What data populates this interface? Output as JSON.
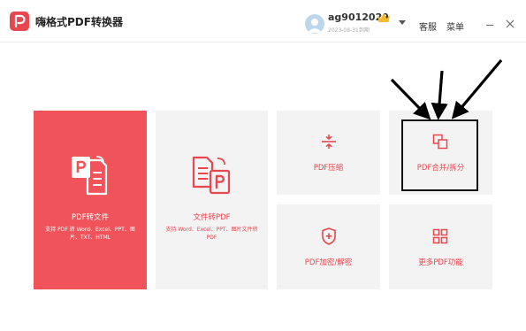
{
  "app": {
    "title": "嗨格式PDF转换器"
  },
  "user": {
    "name": "ag9012029",
    "expiry": "2023-08-31到期"
  },
  "header": {
    "support_label": "客服",
    "menu_label": "菜单"
  },
  "tiles": {
    "pdf_to_file": {
      "label": "PDF转文件",
      "desc": "支持 PDF 转 Word、Excel、PPT、图片、TXT、HTML"
    },
    "file_to_pdf": {
      "label": "文件转PDF",
      "desc": "支持 Word、Excel、PPT、图片文件转 PDF"
    },
    "compress": {
      "label": "PDF压缩"
    },
    "merge_split": {
      "label": "PDF合并/拆分"
    },
    "encrypt": {
      "label": "PDF加密/解密"
    },
    "more": {
      "label": "更多PDF功能"
    }
  },
  "colors": {
    "accent": "#e8474f",
    "tile_red": "#f0545a",
    "tile_gray": "#f3f3f3"
  },
  "icons": [
    "app-logo-icon",
    "avatar-icon",
    "crown-icon",
    "chevron-down-icon",
    "minimize-icon",
    "close-icon",
    "pdf-to-file-icon",
    "file-to-pdf-icon",
    "compress-icon",
    "merge-split-icon",
    "encrypt-icon",
    "grid-icon"
  ]
}
